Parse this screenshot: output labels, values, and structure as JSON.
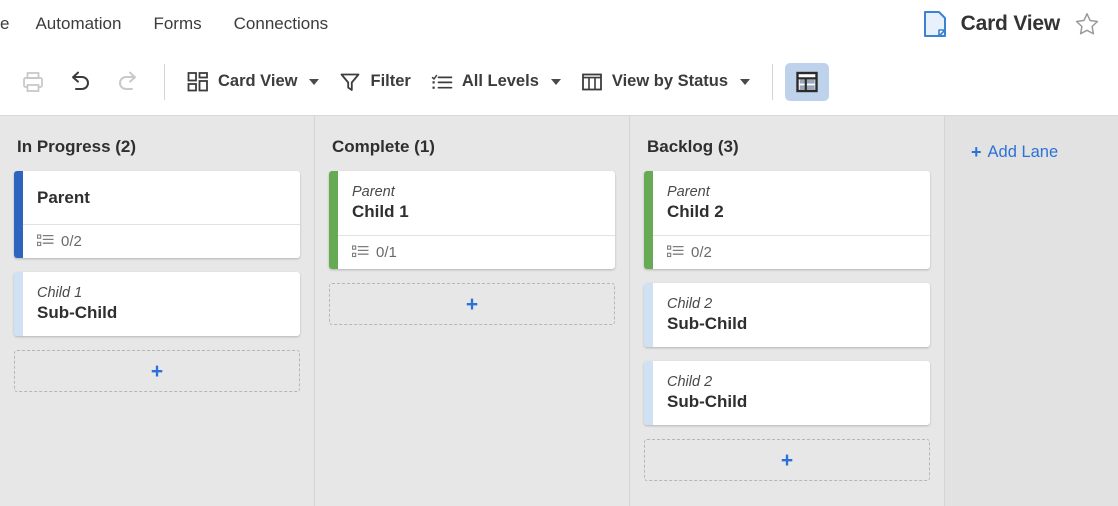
{
  "topnav": {
    "items": [
      {
        "label": "e",
        "truncated": true
      },
      {
        "label": "Automation",
        "truncated": false
      },
      {
        "label": "Forms",
        "truncated": false
      },
      {
        "label": "Connections",
        "truncated": false
      }
    ],
    "doc_icon": "document-icon",
    "view_title": "Card View",
    "star_icon": "star-outline-icon"
  },
  "toolbar": {
    "print_label": "print-icon",
    "undo_label": "undo-icon",
    "redo_label": "redo-icon",
    "view_mode": "Card View",
    "filter_label": "Filter",
    "levels_label": "All Levels",
    "group_label": "View by Status",
    "toggle_label": "table-view-toggle"
  },
  "board": {
    "lanes": [
      {
        "title": "In Progress (2)",
        "add_card_label": "+",
        "cards": [
          {
            "crumb": "",
            "title": "Parent",
            "stripe": "#2c64c0",
            "checklist": "0/2",
            "has_footer": true
          },
          {
            "crumb": "Child 1",
            "title": "Sub-Child",
            "stripe": "#cfe1f2",
            "checklist": "",
            "has_footer": false
          }
        ]
      },
      {
        "title": "Complete (1)",
        "add_card_label": "+",
        "cards": [
          {
            "crumb": "Parent",
            "title": "Child 1",
            "stripe": "#66ab53",
            "checklist": "0/1",
            "has_footer": true
          }
        ]
      },
      {
        "title": "Backlog (3)",
        "add_card_label": "+",
        "cards": [
          {
            "crumb": "Parent",
            "title": "Child 2",
            "stripe": "#66ab53",
            "checklist": "0/2",
            "has_footer": true
          },
          {
            "crumb": "Child 2",
            "title": "Sub-Child",
            "stripe": "#cfe1f2",
            "checklist": "",
            "has_footer": false
          },
          {
            "crumb": "Child 2",
            "title": "Sub-Child",
            "stripe": "#cfe1f2",
            "checklist": "",
            "has_footer": false
          }
        ]
      }
    ],
    "add_lane": {
      "plus": "+",
      "label": "Add Lane"
    }
  },
  "colors": {
    "accent_blue": "#2b72d8",
    "stripe_blue": "#2c64c0",
    "stripe_lightblue": "#cfe1f2",
    "stripe_green": "#66ab53",
    "board_bg": "#e7e7e7",
    "toggle_active_bg": "#bfd2ec"
  }
}
